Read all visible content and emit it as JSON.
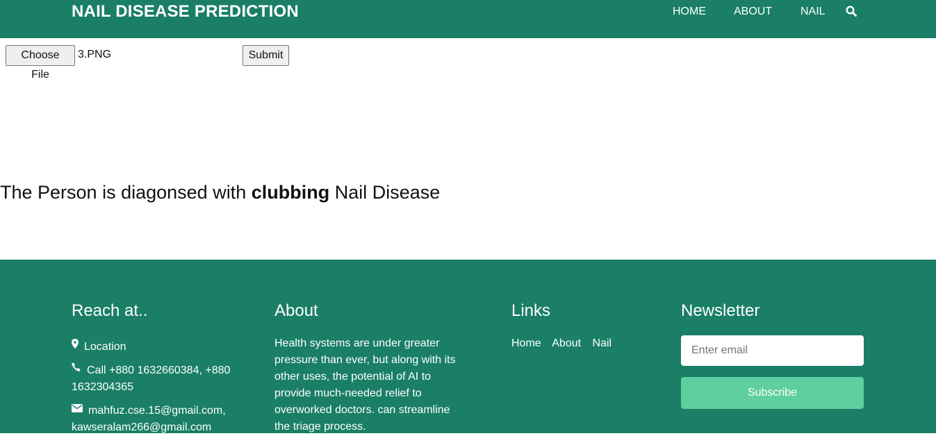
{
  "header": {
    "brand": "NAIL DISEASE PREDICTION",
    "nav": {
      "home": "HOME",
      "about": "ABOUT",
      "nail": "NAIL"
    },
    "search_icon": "search-icon"
  },
  "form": {
    "choose_label": "Choose File",
    "file_name": "3.PNG",
    "submit_label": "Submit"
  },
  "result": {
    "prefix": "The Person is diagonsed with",
    "disease": "clubbing",
    "suffix": "Nail Disease"
  },
  "footer": {
    "reach": {
      "title": "Reach at..",
      "location": "Location",
      "call": "Call +880 1632660384, +880 1632304365",
      "email": "mahfuz.cse.15@gmail.com, kawseralam266@gmail.com"
    },
    "about": {
      "title": "About",
      "text": "Health systems are under greater pressure than ever, but along with its other uses, the potential of AI to provide much-needed relief to overworked doctors. can streamline the triage process."
    },
    "links": {
      "title": "Links",
      "items": [
        "Home",
        "About",
        "Nail"
      ]
    },
    "newsletter": {
      "title": "Newsletter",
      "placeholder": "Enter email",
      "subscribe_label": "Subscribe"
    }
  },
  "colors": {
    "brand_green": "#1a7f66",
    "subscribe_green": "#5fcfa0"
  }
}
